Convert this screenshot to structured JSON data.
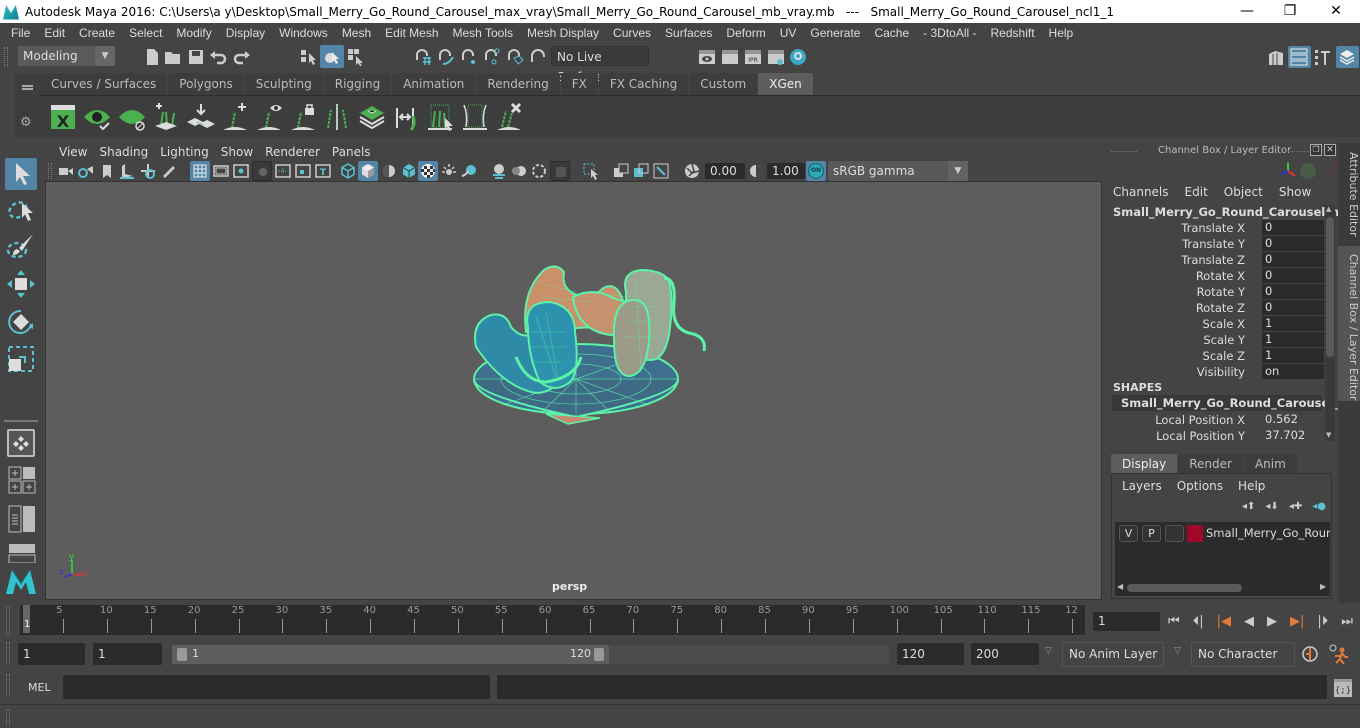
{
  "window": {
    "title": "Autodesk Maya 2016: C:\\Users\\a y\\Desktop\\Small_Merry_Go_Round_Carousel_max_vray\\Small_Merry_Go_Round_Carousel_mb_vray.mb   ---   Small_Merry_Go_Round_Carousel_ncl1_1",
    "minimize": "—",
    "maximize": "❐",
    "close": "✕"
  },
  "menubar": [
    "File",
    "Edit",
    "Create",
    "Select",
    "Modify",
    "Display",
    "Windows",
    "Mesh",
    "Edit Mesh",
    "Mesh Tools",
    "Mesh Display",
    "Curves",
    "Surfaces",
    "Deform",
    "UV",
    "Generate",
    "Cache",
    "- 3DtoAll -",
    "Redshift",
    "Help"
  ],
  "statusline": {
    "menuset": "Modeling",
    "live_surface": "No Live Surface"
  },
  "shelf": {
    "tabs": [
      "Curves / Surfaces",
      "Polygons",
      "Sculpting",
      "Rigging",
      "Animation",
      "Rendering",
      "FX",
      "FX Caching",
      "Custom",
      "XGen"
    ],
    "active_tab": "XGen",
    "icons": [
      "xgen-editor-icon",
      "xgen-preview-icon",
      "xgen-clear-preview-icon",
      "add-guides-icon",
      "place-guides-icon",
      "add-guide-icon",
      "show-guides-icon",
      "lock-guides-icon",
      "guide-split-icon",
      "sculpt-guides-icon",
      "flip-guides-icon",
      "select-guides-icon",
      "guide-box-icon",
      "delete-guides-icon"
    ]
  },
  "viewport": {
    "menus": [
      "View",
      "Shading",
      "Lighting",
      "Show",
      "Renderer",
      "Panels"
    ],
    "exposure": "0.00",
    "gamma": "1.00",
    "color_mgmt_badge": "ON",
    "color_space": "sRGB gamma",
    "camera_label": "persp",
    "axis": {
      "x": "x",
      "y": "y",
      "z": "z"
    }
  },
  "channel_box": {
    "title": "Channel Box / Layer Editor",
    "menus": [
      "Channels",
      "Edit",
      "Object",
      "Show"
    ],
    "object_name": "Small_Merry_Go_Round_Carousel_ncl...",
    "channels": [
      {
        "label": "Translate X",
        "value": "0"
      },
      {
        "label": "Translate Y",
        "value": "0"
      },
      {
        "label": "Translate Z",
        "value": "0"
      },
      {
        "label": "Rotate X",
        "value": "0"
      },
      {
        "label": "Rotate Y",
        "value": "0"
      },
      {
        "label": "Rotate Z",
        "value": "0"
      },
      {
        "label": "Scale X",
        "value": "1"
      },
      {
        "label": "Scale Y",
        "value": "1"
      },
      {
        "label": "Scale Z",
        "value": "1"
      },
      {
        "label": "Visibility",
        "value": "on"
      }
    ],
    "shapes_header": "SHAPES",
    "shape_name": "Small_Merry_Go_Round_Carousel_n...",
    "shape_channels": [
      {
        "label": "Local Position X",
        "value": "0.562"
      },
      {
        "label": "Local Position Y",
        "value": "37.702"
      }
    ]
  },
  "layer_editor": {
    "tabs": [
      "Display",
      "Render",
      "Anim"
    ],
    "active_tab": "Display",
    "menus": [
      "Layers",
      "Options",
      "Help"
    ],
    "layers": [
      {
        "v": "V",
        "p": "P",
        "color": "#a0082a",
        "name": "Small_Merry_Go_Round_"
      }
    ]
  },
  "side_tabs": [
    "Attribute Editor",
    "Channel Box / Layer Editor"
  ],
  "timeline": {
    "ticks": [
      "5",
      "10",
      "15",
      "20",
      "25",
      "30",
      "35",
      "40",
      "45",
      "50",
      "55",
      "60",
      "65",
      "70",
      "75",
      "80",
      "85",
      "90",
      "95",
      "100",
      "105",
      "110",
      "115",
      "12"
    ],
    "current_frame_marker": "1",
    "current_frame": "1"
  },
  "range": {
    "start": "1",
    "playback_start": "1",
    "range_start": "1",
    "range_end": "120",
    "playback_end": "120",
    "end": "200",
    "anim_layer": "No Anim Layer",
    "character_set": "No Character Set"
  },
  "cmdline": {
    "label": "MEL"
  },
  "colors": {
    "accent": "#5285a6",
    "wire": "#5cf2a8",
    "timeline_marker": "#e07b39"
  }
}
